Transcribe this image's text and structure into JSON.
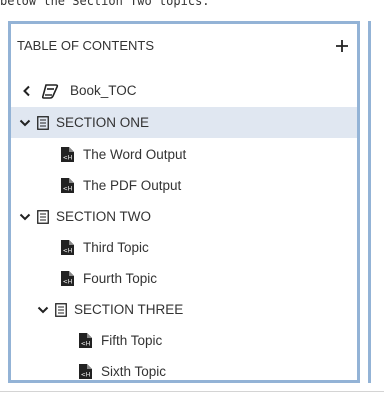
{
  "caption": "below the Section Two topics.",
  "toc": {
    "title": "TABLE OF CONTENTS",
    "add_icon": "plus-icon",
    "book": {
      "label": "Book_TOC",
      "back_icon": "chevron-left-icon",
      "icon": "book-icon"
    },
    "sections": [
      {
        "label": "SECTION ONE",
        "selected": true,
        "expanded": true,
        "icon": "section-document-icon"
      },
      {
        "label": "SECTION TWO",
        "selected": false,
        "expanded": true,
        "icon": "section-document-icon"
      },
      {
        "label": "SECTION THREE",
        "selected": false,
        "expanded": true,
        "icon": "section-document-icon"
      }
    ],
    "topics": [
      {
        "label": "The Word Output",
        "section": "SECTION ONE",
        "icon": "html-topic-icon"
      },
      {
        "label": "The PDF Output",
        "section": "SECTION ONE",
        "icon": "html-topic-icon"
      },
      {
        "label": "Third Topic",
        "section": "SECTION TWO",
        "icon": "html-topic-icon"
      },
      {
        "label": "Fourth Topic",
        "section": "SECTION TWO",
        "icon": "html-topic-icon"
      },
      {
        "label": "Fifth Topic",
        "section": "SECTION THREE",
        "icon": "html-topic-icon"
      },
      {
        "label": "Sixth Topic",
        "section": "SECTION THREE",
        "icon": "html-topic-icon"
      }
    ],
    "colors": {
      "border": "#93b3d6",
      "selected_background": "#e0e7f1",
      "text": "#333333"
    }
  }
}
